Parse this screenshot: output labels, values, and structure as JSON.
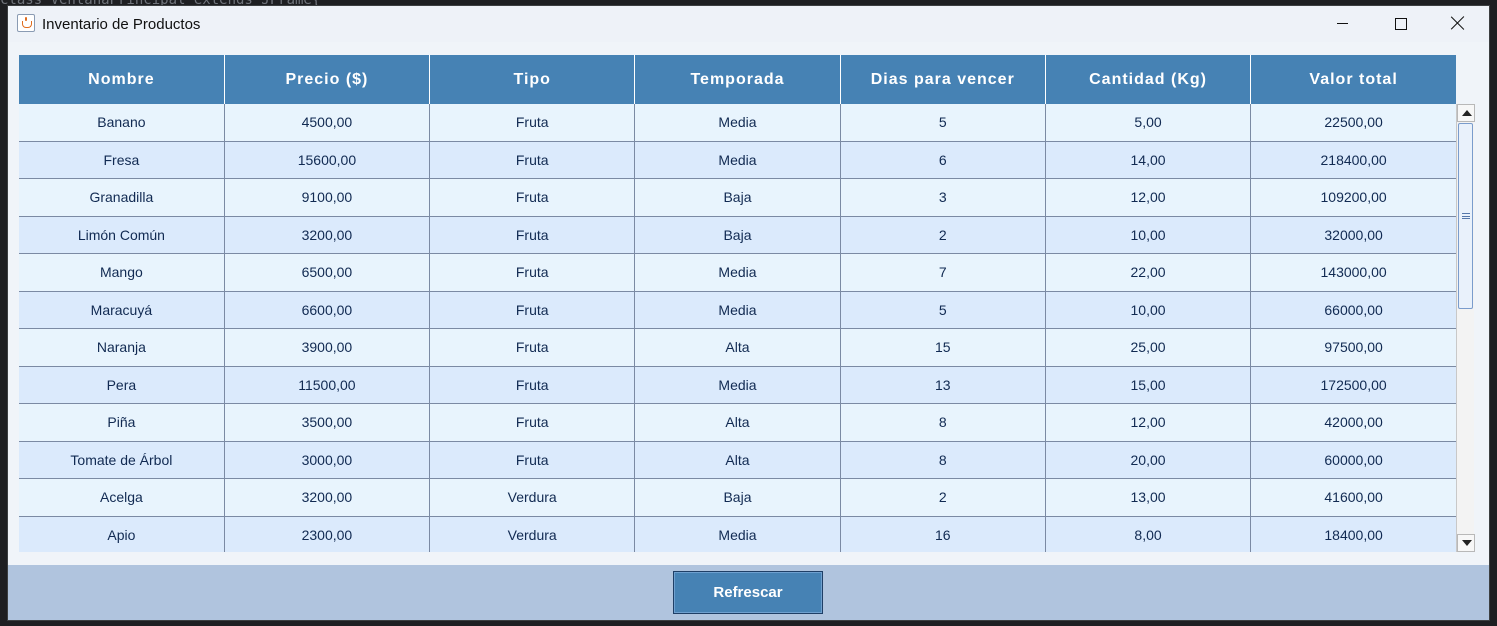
{
  "window": {
    "title": "Inventario de Productos"
  },
  "background": {
    "code_snippet": "class VentanaPrincipal extends JFrame{"
  },
  "table": {
    "headers": [
      "Nombre",
      "Precio ($)",
      "Tipo",
      "Temporada",
      "Dias para vencer",
      "Cantidad (Kg)",
      "Valor total"
    ],
    "rows": [
      [
        "Banano",
        "4500,00",
        "Fruta",
        "Media",
        "5",
        "5,00",
        "22500,00"
      ],
      [
        "Fresa",
        "15600,00",
        "Fruta",
        "Media",
        "6",
        "14,00",
        "218400,00"
      ],
      [
        "Granadilla",
        "9100,00",
        "Fruta",
        "Baja",
        "3",
        "12,00",
        "109200,00"
      ],
      [
        "Limón Común",
        "3200,00",
        "Fruta",
        "Baja",
        "2",
        "10,00",
        "32000,00"
      ],
      [
        "Mango",
        "6500,00",
        "Fruta",
        "Media",
        "7",
        "22,00",
        "143000,00"
      ],
      [
        "Maracuyá",
        "6600,00",
        "Fruta",
        "Media",
        "5",
        "10,00",
        "66000,00"
      ],
      [
        "Naranja",
        "3900,00",
        "Fruta",
        "Alta",
        "15",
        "25,00",
        "97500,00"
      ],
      [
        "Pera",
        "11500,00",
        "Fruta",
        "Media",
        "13",
        "15,00",
        "172500,00"
      ],
      [
        "Piña",
        "3500,00",
        "Fruta",
        "Alta",
        "8",
        "12,00",
        "42000,00"
      ],
      [
        "Tomate de Árbol",
        "3000,00",
        "Fruta",
        "Alta",
        "8",
        "20,00",
        "60000,00"
      ],
      [
        "Acelga",
        "3200,00",
        "Verdura",
        "Baja",
        "2",
        "13,00",
        "41600,00"
      ],
      [
        "Apio",
        "2300,00",
        "Verdura",
        "Media",
        "16",
        "8,00",
        "18400,00"
      ]
    ]
  },
  "footer": {
    "refresh_label": "Refrescar"
  },
  "colors": {
    "header_bg": "#4682b4",
    "row_odd": "#e8f4fd",
    "row_even": "#dbeafc",
    "bottom_bar": "#b0c4de",
    "button_bg": "#4682b4"
  },
  "icons": {
    "app": "java-cup-icon",
    "minimize": "minimize-icon",
    "maximize": "maximize-icon",
    "close": "close-icon"
  }
}
